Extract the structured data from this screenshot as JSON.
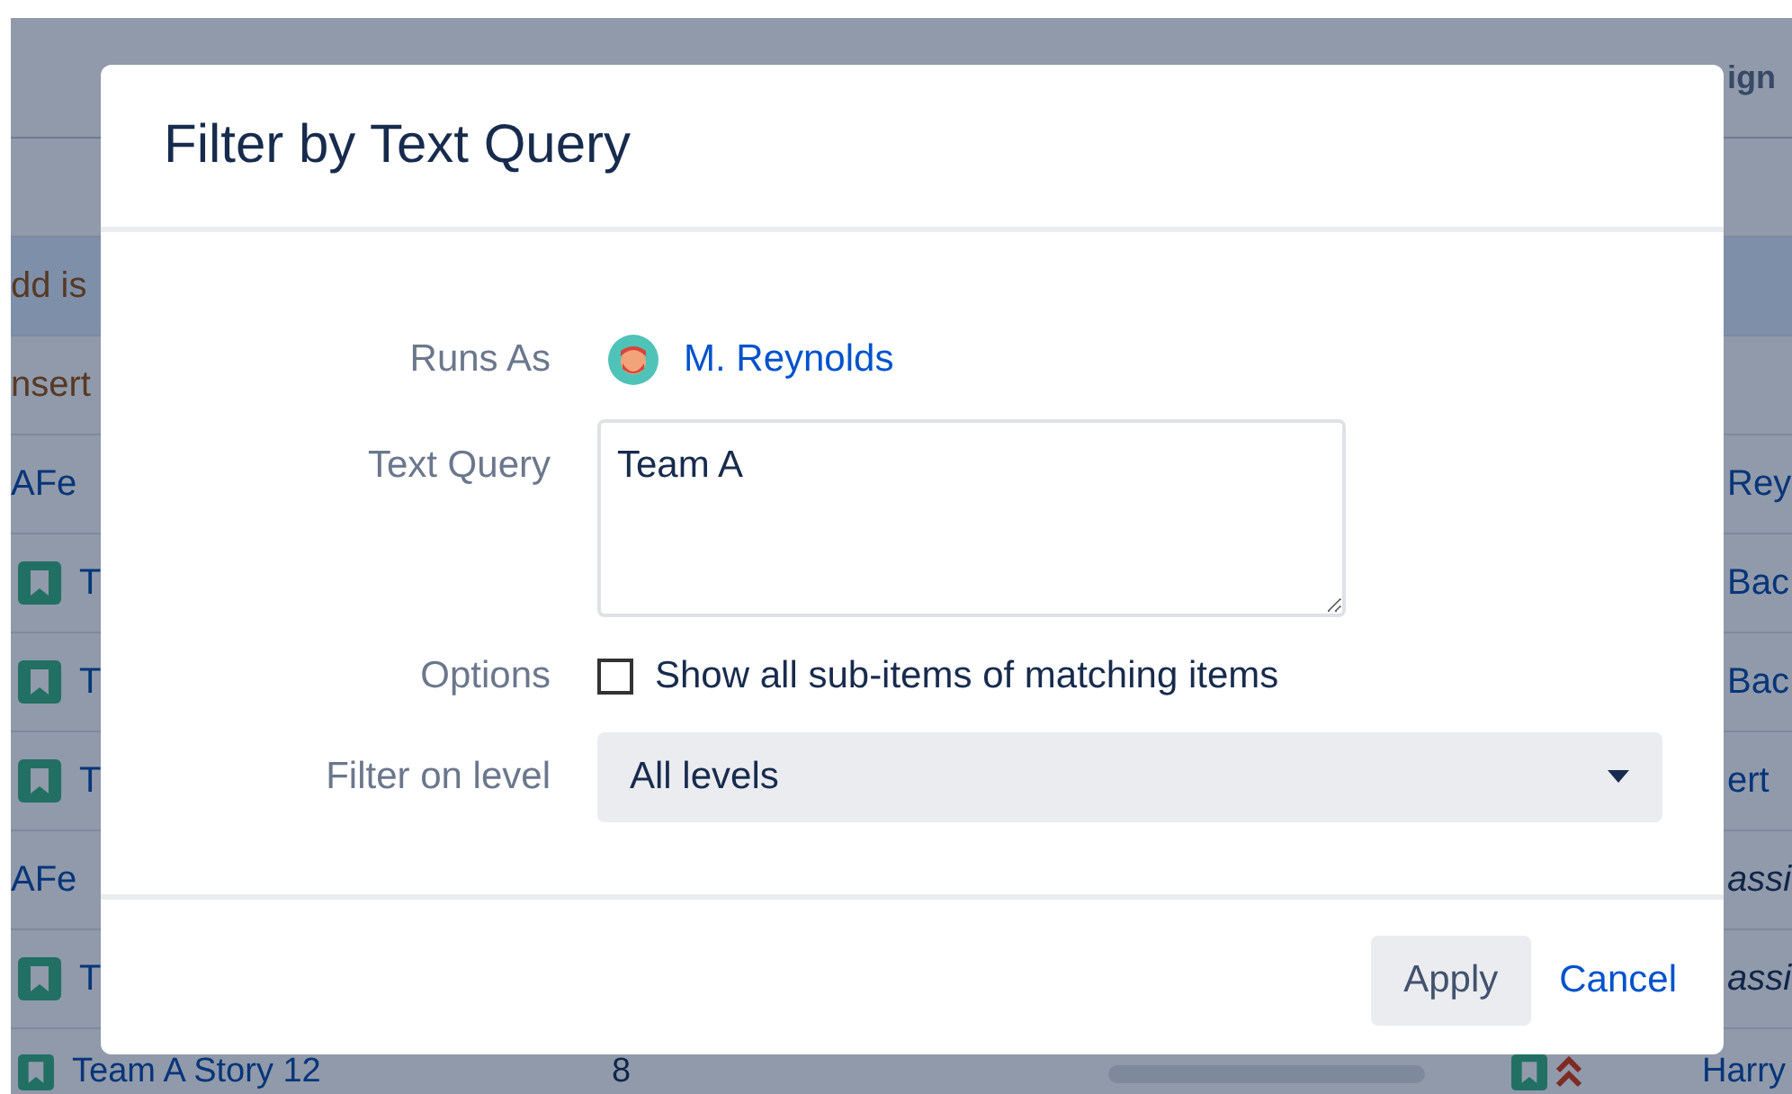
{
  "background_table": {
    "header": "ign",
    "rows": [
      {
        "kind": "blank",
        "highlighted": false
      },
      {
        "kind": "action",
        "left": "dd is",
        "highlighted": true
      },
      {
        "kind": "action",
        "left": "nsert",
        "highlighted": false
      },
      {
        "kind": "epic",
        "left": "AFe",
        "right": "Rey",
        "highlighted": false
      },
      {
        "kind": "story",
        "left": "T",
        "right": "Bac",
        "highlighted": false
      },
      {
        "kind": "story",
        "left": "T",
        "right": "Bac",
        "highlighted": false
      },
      {
        "kind": "story",
        "left": "T",
        "right": "ert",
        "highlighted": false
      },
      {
        "kind": "epic",
        "left": "AFe",
        "right": "assi",
        "unassigned": true,
        "highlighted": false
      },
      {
        "kind": "story",
        "left": "T",
        "right": "assi",
        "unassigned": true,
        "highlighted": false
      },
      {
        "kind": "story",
        "left": "Team A Story 12",
        "estimate": "8",
        "level": 0,
        "right": "Harry",
        "high_priority": true,
        "highlighted": false
      }
    ]
  },
  "dialog": {
    "title": "Filter by Text Query",
    "runs_as": {
      "label": "Runs As",
      "user": "M. Reynolds"
    },
    "text_query": {
      "label": "Text Query",
      "value": "Team A"
    },
    "options": {
      "label": "Options",
      "checkbox_label": "Show all sub-items of matching items",
      "checked": false
    },
    "filter_level": {
      "label": "Filter on level",
      "value": "All levels"
    },
    "buttons": {
      "apply": "Apply",
      "cancel": "Cancel"
    }
  }
}
